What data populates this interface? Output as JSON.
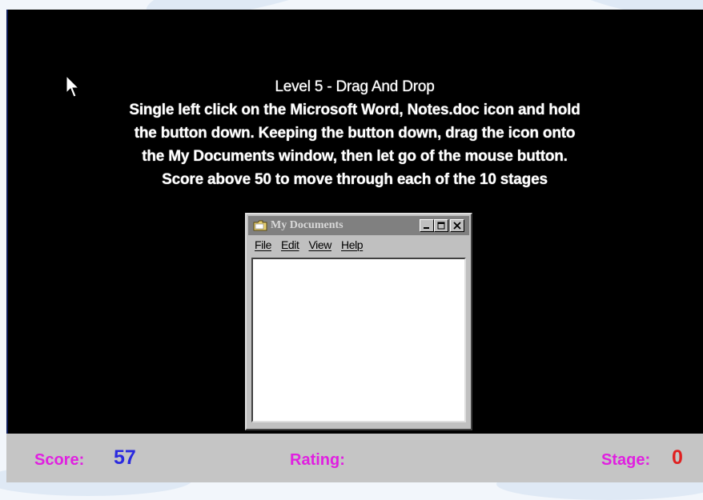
{
  "instructions": {
    "title": "Level 5 - Drag And Drop",
    "lines": [
      "Single left click on the Microsoft Word, Notes.doc icon and hold",
      "the button down. Keeping the button down, drag the icon onto",
      "the My Documents window, then let go of the mouse button.",
      "Score above 50 to move through each of the 10 stages"
    ]
  },
  "window": {
    "title": "My Documents",
    "title_icon": "folder-icon",
    "buttons": [
      "minimize-icon",
      "maximize-icon",
      "close-icon"
    ],
    "menu": [
      "File",
      "Edit",
      "View",
      "Help"
    ]
  },
  "status": {
    "score_label": "Score:",
    "score_value": "57",
    "rating_label": "Rating:",
    "rating_value": "",
    "stage_label": "Stage:",
    "stage_value": "0"
  },
  "colors": {
    "background": "#000000",
    "status_bar": "#c5c5c5",
    "label": "#e020e0",
    "score_value": "#2a2ae0",
    "stage_value": "#e02020"
  }
}
